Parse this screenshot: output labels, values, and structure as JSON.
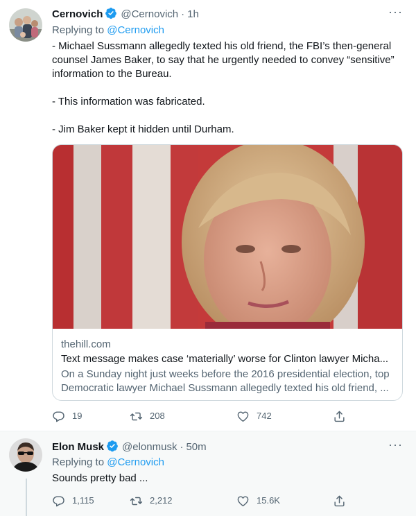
{
  "colors": {
    "accent": "#1d9bf0",
    "secondary_text": "#536471",
    "primary_text": "#0f1419",
    "border": "#cfd9de"
  },
  "tweets": [
    {
      "author_name": "Cernovich",
      "handle": "@Cernovich",
      "separator": "·",
      "time": "1h",
      "replying_prefix": "Replying to",
      "replying_mention": "@Cernovich",
      "paragraphs": [
        "- Michael Sussmann allegedly texted his old friend, the FBI’s then-general counsel James Baker, to say that he urgently needed to convey “sensitive” information to the Bureau.",
        "- This information was fabricated.",
        "- Jim Baker kept it hidden until Durham."
      ],
      "card": {
        "domain": "thehill.com",
        "title": "Text message makes case ‘materially’ worse for Clinton lawyer Micha...",
        "description": "On a Sunday night just weeks before the 2016 presidential election, top Democratic lawyer Michael Sussmann allegedly texted his old friend, ..."
      },
      "counts": {
        "replies": "19",
        "retweets": "208",
        "likes": "742"
      }
    },
    {
      "author_name": "Elon Musk",
      "handle": "@elonmusk",
      "separator": "·",
      "time": "50m",
      "replying_prefix": "Replying to",
      "replying_mention": "@Cernovich",
      "paragraphs": [
        "Sounds pretty bad ..."
      ],
      "counts": {
        "replies": "1,115",
        "retweets": "2,212",
        "likes": "15.6K"
      }
    }
  ],
  "icons": {
    "verified": "verified-badge-icon",
    "more": "more-dots-icon",
    "reply": "reply-bubble-icon",
    "retweet": "retweet-icon",
    "like": "heart-icon",
    "share": "share-icon"
  }
}
